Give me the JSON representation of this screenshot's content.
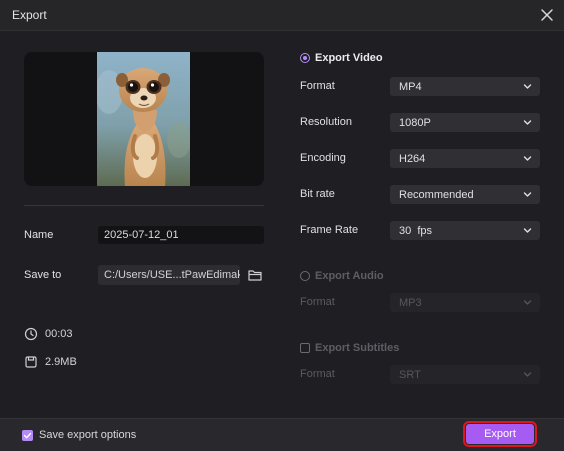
{
  "window": {
    "title": "Export",
    "close_icon": "close-icon"
  },
  "left": {
    "name_label": "Name",
    "name_value": "2025-07-12_01",
    "save_to_label": "Save to",
    "save_to_value": "C:/Users/USE...tPawEdimakor",
    "folder_icon": "folder-icon",
    "duration": "00:03",
    "size": "2.9MB"
  },
  "video": {
    "section": "Export Video",
    "selected": true,
    "fields": {
      "format": {
        "label": "Format",
        "value": "MP4"
      },
      "resolution": {
        "label": "Resolution",
        "value": "1080P"
      },
      "encoding": {
        "label": "Encoding",
        "value": "H264"
      },
      "bitrate": {
        "label": "Bit rate",
        "value": "Recommended"
      },
      "framerate": {
        "label": "Frame Rate",
        "value": "30  fps"
      }
    }
  },
  "audio": {
    "section": "Export Audio",
    "selected": false,
    "format_label": "Format",
    "format_value": "MP3"
  },
  "subtitles": {
    "section": "Export Subtitles",
    "checked": false,
    "format_label": "Format",
    "format_value": "SRT"
  },
  "footer": {
    "save_options_label": "Save export options",
    "save_options_checked": true,
    "export_label": "Export"
  },
  "colors": {
    "accent": "#a65cf2",
    "highlight_border": "#e0151f",
    "background": "#1f1f23"
  }
}
